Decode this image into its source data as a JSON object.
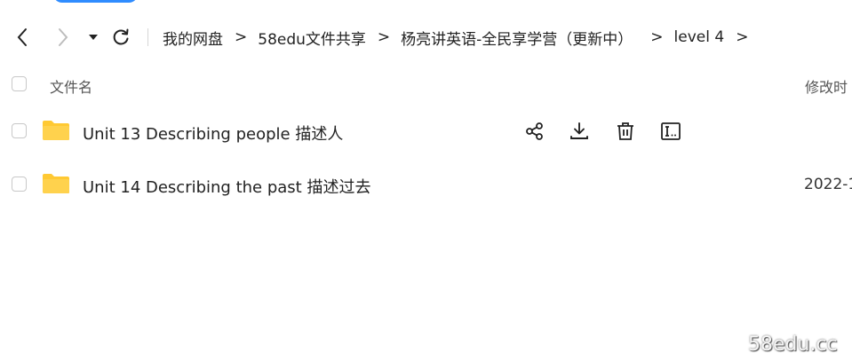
{
  "breadcrumb": {
    "items": [
      "我的网盘",
      "58edu文件共享",
      "杨亮讲英语-全民享学营（更新中）",
      "level 4"
    ],
    "separator": ">"
  },
  "list_header": {
    "name_label": "文件名",
    "modified_label": "修改时"
  },
  "files": [
    {
      "name": "Unit 13 Describing people 描述人",
      "modified": "",
      "icon": "folder-icon"
    },
    {
      "name": "Unit 14 Describing the past 描述过去",
      "modified": "2022-1",
      "icon": "folder-icon"
    }
  ],
  "row_actions": [
    "share-icon",
    "download-icon",
    "delete-icon",
    "rename-icon"
  ],
  "colors": {
    "folder": "#ffc933",
    "accent": "#2f8cff"
  },
  "watermark": "58edu.cc"
}
